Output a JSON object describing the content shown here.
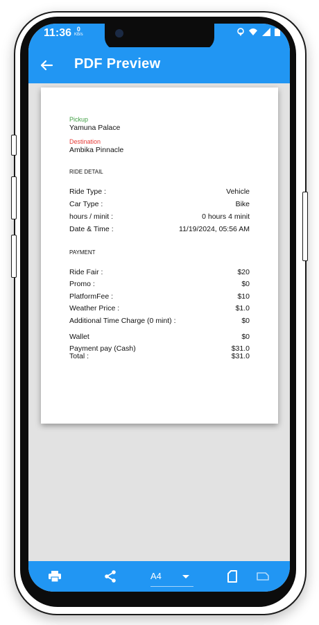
{
  "status_bar": {
    "time": "11:36",
    "net_speed_value": "0",
    "net_speed_unit": "KB/s"
  },
  "app_bar": {
    "title": "PDF Preview",
    "back_icon": "arrow-left-icon"
  },
  "pdf": {
    "pickup_label": "Pickup",
    "pickup_value": "Yamuna Palace",
    "destination_label": "Destination",
    "destination_value": "Ambika Pinnacle",
    "ride_detail_heading": "RIDE DETAIL",
    "ride_detail": [
      {
        "label": "Ride Type :",
        "value": "Vehicle"
      },
      {
        "label": "Car Type :",
        "value": "Bike"
      },
      {
        "label": "hours / minit :",
        "value": "0 hours 4 minit"
      },
      {
        "label": "Date & Time :",
        "value": "11/19/2024, 05:56 AM"
      }
    ],
    "payment_heading": "PAYMENT",
    "payment": [
      {
        "label": "Ride Fair :",
        "value": "$20"
      },
      {
        "label": "Promo :",
        "value": "$0"
      },
      {
        "label": "PlatformFee :",
        "value": "$10"
      },
      {
        "label": "Weather Price :",
        "value": "$1.0"
      },
      {
        "label": "Additional Time Charge (0 mint) :",
        "value": "$0"
      }
    ],
    "wallet": {
      "label": "Wallet",
      "value": "$0"
    },
    "payment_pay": {
      "label": "Payment pay (Cash)",
      "value": "$31.0"
    },
    "total": {
      "label": "Total :",
      "value": "$31.0"
    }
  },
  "bottom_bar": {
    "print_icon": "print-icon",
    "share_icon": "share-icon",
    "page_size": "A4",
    "portrait_icon": "portrait-page-icon",
    "landscape_icon": "landscape-page-icon"
  },
  "colors": {
    "primary": "#2196f3",
    "pickup_green": "#43a047",
    "destination_red": "#e53935"
  }
}
